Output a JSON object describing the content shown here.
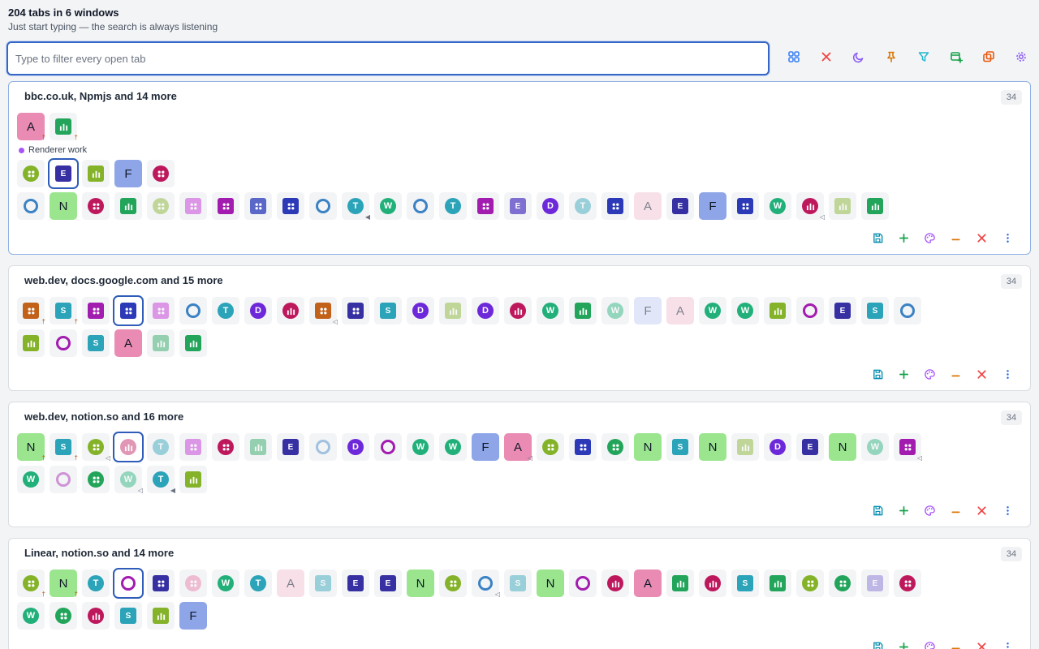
{
  "header": {
    "title": "204 tabs in 6 windows",
    "subtitle": "Just start typing — the search is always listening"
  },
  "search": {
    "placeholder": "Type to filter every open tab",
    "value": ""
  },
  "toolbar": {
    "buttons": [
      {
        "icon": "grid-icon",
        "color": "#3b82f6"
      },
      {
        "icon": "close-x-icon",
        "color": "#ef4444"
      },
      {
        "icon": "moon-icon",
        "color": "#8b5cf6"
      },
      {
        "icon": "pin-icon",
        "color": "#d97706"
      },
      {
        "icon": "filter-icon",
        "color": "#22b8cf"
      },
      {
        "icon": "new-window-icon",
        "color": "#16a34a"
      },
      {
        "icon": "duplicate-icon",
        "color": "#ea580c"
      },
      {
        "icon": "settings-gear-icon",
        "color": "#8b5cf6"
      }
    ]
  },
  "palette": {
    "green": "#65a30d",
    "lime": "#84cc16",
    "indigo": "#3730a3",
    "purple": "#a21caf",
    "magenta": "#be185d",
    "blue": "#3b82c4",
    "teal": "#2ba3b8",
    "emerald": "#22a55a",
    "violet": "#6d28d9",
    "royal": "#2c3ab8",
    "pink": "#e879a6",
    "periwinkle": "#8ea6e8",
    "orange": "#c2611a",
    "lavender": "#7f6fd1"
  },
  "windows": [
    {
      "title": "bbc.co.uk, Npmjs and 14 more",
      "count": "34",
      "group_label": "Renderer work",
      "pinned_row": [
        {
          "kind": "big",
          "letter": "A",
          "bg": "#e98bb3",
          "badge": "pin"
        },
        {
          "kind": "sq",
          "icon": "bars",
          "bg": "#22a55a",
          "badge": "pin"
        }
      ],
      "group_row": [
        {
          "kind": "dots",
          "bg": "#84b32a"
        },
        {
          "kind": "sq",
          "letter": "E",
          "bg": "#3730a3",
          "selected": true
        },
        {
          "kind": "sq",
          "icon": "bars",
          "bg": "#84b32a"
        },
        {
          "kind": "big",
          "letter": "F",
          "bg": "#8ea6e8"
        },
        {
          "kind": "dots",
          "bg": "#be185d"
        }
      ],
      "rows": [
        [
          {
            "kind": "ring",
            "bg": "#3b82c4"
          },
          {
            "kind": "big",
            "letter": "N",
            "bg": "#9be58f"
          },
          {
            "kind": "dots",
            "bg": "#be185d"
          },
          {
            "kind": "sq",
            "icon": "bars",
            "bg": "#22a55a"
          },
          {
            "kind": "dots",
            "bg": "#84b32a",
            "faded": true
          },
          {
            "kind": "sq",
            "icon": "dots",
            "bg": "#c026d3",
            "faded": true
          },
          {
            "kind": "sq",
            "icon": "dots",
            "bg": "#a21caf"
          },
          {
            "kind": "sq",
            "icon": "dots",
            "bg": "#5b68c8"
          },
          {
            "kind": "sq",
            "icon": "dots",
            "bg": "#2c3ab8"
          },
          {
            "kind": "ring",
            "bg": "#3b82c4"
          },
          {
            "kind": "circle",
            "letter": "T",
            "bg": "#2ba3b8",
            "badge": "sound"
          },
          {
            "kind": "circle",
            "letter": "W",
            "bg": "#22b07a"
          },
          {
            "kind": "ring",
            "bg": "#3b82c4"
          },
          {
            "kind": "circle",
            "letter": "T",
            "bg": "#2ba3b8"
          },
          {
            "kind": "sq",
            "icon": "dots",
            "bg": "#a21caf"
          },
          {
            "kind": "sq",
            "letter": "E",
            "bg": "#7f6fd1"
          },
          {
            "kind": "circle",
            "letter": "D",
            "bg": "#6d28d9"
          },
          {
            "kind": "circle",
            "letter": "T",
            "bg": "#2ba3b8",
            "faded": true
          },
          {
            "kind": "sq",
            "icon": "dots",
            "bg": "#2c3ab8"
          },
          {
            "kind": "big",
            "letter": "A",
            "bg": "#f3c7d8",
            "faded": true
          },
          {
            "kind": "sq",
            "letter": "E",
            "bg": "#3730a3"
          },
          {
            "kind": "big",
            "letter": "F",
            "bg": "#8ea6e8"
          },
          {
            "kind": "sq",
            "icon": "dots",
            "bg": "#2c3ab8"
          },
          {
            "kind": "circle",
            "letter": "W",
            "bg": "#22b07a"
          },
          {
            "kind": "circle",
            "icon": "bars",
            "bg": "#be185d",
            "badge": "mute"
          },
          {
            "kind": "sq",
            "icon": "bars",
            "bg": "#84b32a",
            "faded": true
          },
          {
            "kind": "sq",
            "icon": "bars",
            "bg": "#22a55a"
          }
        ]
      ]
    },
    {
      "title": "web.dev, docs.google.com and 15 more",
      "count": "34",
      "rows": [
        [
          {
            "kind": "sq",
            "icon": "dots",
            "bg": "#c2611a",
            "badge": "pin"
          },
          {
            "kind": "sq",
            "letter": "S",
            "bg": "#2ba3b8",
            "badge": "pin"
          },
          {
            "kind": "sq",
            "icon": "dots",
            "bg": "#a21caf"
          },
          {
            "kind": "sq",
            "icon": "dots",
            "bg": "#2c3ab8",
            "selected": true
          },
          {
            "kind": "sq",
            "icon": "dots",
            "bg": "#c026d3",
            "faded": true
          },
          {
            "kind": "ring",
            "bg": "#3b82c4"
          },
          {
            "kind": "circle",
            "letter": "T",
            "bg": "#2ba3b8"
          },
          {
            "kind": "circle",
            "letter": "D",
            "bg": "#6d28d9"
          },
          {
            "kind": "circle",
            "icon": "bars",
            "bg": "#be185d"
          },
          {
            "kind": "sq",
            "icon": "dots",
            "bg": "#c2611a",
            "badge": "mute"
          },
          {
            "kind": "sq",
            "icon": "dots",
            "bg": "#3730a3"
          },
          {
            "kind": "sq",
            "letter": "S",
            "bg": "#2ba3b8"
          },
          {
            "kind": "circle",
            "letter": "D",
            "bg": "#6d28d9"
          },
          {
            "kind": "sq",
            "icon": "bars",
            "bg": "#84b32a",
            "faded": true
          },
          {
            "kind": "circle",
            "letter": "D",
            "bg": "#6d28d9"
          },
          {
            "kind": "circle",
            "icon": "bars",
            "bg": "#be185d"
          },
          {
            "kind": "circle",
            "letter": "W",
            "bg": "#22b07a"
          },
          {
            "kind": "sq",
            "icon": "bars",
            "bg": "#22a55a"
          },
          {
            "kind": "circle",
            "letter": "W",
            "bg": "#22b07a",
            "faded": true
          },
          {
            "kind": "big",
            "letter": "F",
            "bg": "#c9d4f5",
            "faded": true
          },
          {
            "kind": "big",
            "letter": "A",
            "bg": "#f3c7d8",
            "faded": true
          },
          {
            "kind": "circle",
            "letter": "W",
            "bg": "#22b07a"
          },
          {
            "kind": "circle",
            "letter": "W",
            "bg": "#22b07a"
          },
          {
            "kind": "sq",
            "icon": "bars",
            "bg": "#84b32a"
          },
          {
            "kind": "ring",
            "bg": "#a21caf"
          },
          {
            "kind": "sq",
            "letter": "E",
            "bg": "#3730a3"
          },
          {
            "kind": "sq",
            "letter": "S",
            "bg": "#2ba3b8"
          },
          {
            "kind": "ring",
            "bg": "#3b82c4"
          }
        ],
        [
          {
            "kind": "sq",
            "icon": "bars",
            "bg": "#84b32a"
          },
          {
            "kind": "ring",
            "bg": "#a21caf"
          },
          {
            "kind": "sq",
            "letter": "S",
            "bg": "#2ba3b8"
          },
          {
            "kind": "big",
            "letter": "A",
            "bg": "#e98bb3"
          },
          {
            "kind": "sq",
            "icon": "bars",
            "bg": "#22a55a",
            "faded": true
          },
          {
            "kind": "sq",
            "icon": "bars",
            "bg": "#22a55a"
          }
        ]
      ]
    },
    {
      "title": "web.dev, notion.so and 16 more",
      "count": "34",
      "rows": [
        [
          {
            "kind": "big",
            "letter": "N",
            "bg": "#9be58f",
            "badge": "pin"
          },
          {
            "kind": "sq",
            "letter": "S",
            "bg": "#2ba3b8",
            "badge": "pin"
          },
          {
            "kind": "dots",
            "bg": "#84b32a",
            "badge": "mute"
          },
          {
            "kind": "circle",
            "icon": "bars",
            "bg": "#be185d",
            "selected": true,
            "faded": true
          },
          {
            "kind": "circle",
            "letter": "T",
            "bg": "#2ba3b8",
            "faded": true
          },
          {
            "kind": "sq",
            "icon": "dots",
            "bg": "#c026d3",
            "faded": true
          },
          {
            "kind": "dots",
            "bg": "#be185d"
          },
          {
            "kind": "sq",
            "icon": "bars",
            "bg": "#22a55a",
            "faded": true
          },
          {
            "kind": "sq",
            "letter": "E",
            "bg": "#3730a3"
          },
          {
            "kind": "ring",
            "bg": "#3b82c4",
            "faded": true
          },
          {
            "kind": "circle",
            "letter": "D",
            "bg": "#6d28d9"
          },
          {
            "kind": "ring",
            "bg": "#a21caf"
          },
          {
            "kind": "circle",
            "letter": "W",
            "bg": "#22b07a"
          },
          {
            "kind": "circle",
            "letter": "W",
            "bg": "#22b07a"
          },
          {
            "kind": "big",
            "letter": "F",
            "bg": "#8ea6e8"
          },
          {
            "kind": "big",
            "letter": "A",
            "bg": "#e98bb3",
            "badge": "mute"
          },
          {
            "kind": "dots",
            "bg": "#84b32a"
          },
          {
            "kind": "sq",
            "icon": "dots",
            "bg": "#2c3ab8"
          },
          {
            "kind": "dots",
            "bg": "#22a55a"
          },
          {
            "kind": "big",
            "letter": "N",
            "bg": "#9be58f"
          },
          {
            "kind": "sq",
            "letter": "S",
            "bg": "#2ba3b8"
          },
          {
            "kind": "big",
            "letter": "N",
            "bg": "#9be58f"
          },
          {
            "kind": "sq",
            "icon": "bars",
            "bg": "#84b32a",
            "faded": true
          },
          {
            "kind": "circle",
            "letter": "D",
            "bg": "#6d28d9"
          },
          {
            "kind": "sq",
            "letter": "E",
            "bg": "#3730a3"
          },
          {
            "kind": "big",
            "letter": "N",
            "bg": "#9be58f"
          },
          {
            "kind": "circle",
            "letter": "W",
            "bg": "#22b07a",
            "faded": true
          },
          {
            "kind": "sq",
            "icon": "dots",
            "bg": "#a21caf",
            "badge": "mute"
          }
        ],
        [
          {
            "kind": "circle",
            "letter": "W",
            "bg": "#22b07a"
          },
          {
            "kind": "ring",
            "bg": "#a21caf",
            "faded": true
          },
          {
            "kind": "dots",
            "bg": "#22a55a"
          },
          {
            "kind": "circle",
            "letter": "W",
            "bg": "#22b07a",
            "faded": true,
            "badge": "mute"
          },
          {
            "kind": "circle",
            "letter": "T",
            "bg": "#2ba3b8",
            "badge": "sound"
          },
          {
            "kind": "sq",
            "icon": "bars",
            "bg": "#84b32a"
          }
        ]
      ]
    },
    {
      "title": "Linear, notion.so and 14 more",
      "count": "34",
      "rows": [
        [
          {
            "kind": "dots",
            "bg": "#84b32a",
            "badge": "pin"
          },
          {
            "kind": "big",
            "letter": "N",
            "bg": "#9be58f",
            "badge": "pin"
          },
          {
            "kind": "circle",
            "letter": "T",
            "bg": "#2ba3b8"
          },
          {
            "kind": "ring",
            "bg": "#a21caf",
            "selected": true
          },
          {
            "kind": "sq",
            "icon": "dots",
            "bg": "#3730a3"
          },
          {
            "kind": "dots",
            "bg": "#e879a6",
            "faded": true
          },
          {
            "kind": "circle",
            "letter": "W",
            "bg": "#22b07a"
          },
          {
            "kind": "circle",
            "letter": "T",
            "bg": "#2ba3b8"
          },
          {
            "kind": "big",
            "letter": "A",
            "bg": "#f3c7d8",
            "faded": true
          },
          {
            "kind": "sq",
            "letter": "S",
            "bg": "#2ba3b8",
            "faded": true
          },
          {
            "kind": "sq",
            "letter": "E",
            "bg": "#3730a3"
          },
          {
            "kind": "sq",
            "letter": "E",
            "bg": "#3730a3"
          },
          {
            "kind": "big",
            "letter": "N",
            "bg": "#9be58f"
          },
          {
            "kind": "dots",
            "bg": "#84b32a"
          },
          {
            "kind": "ring",
            "bg": "#3b82c4",
            "badge": "mute"
          },
          {
            "kind": "sq",
            "letter": "S",
            "bg": "#2ba3b8",
            "faded": true
          },
          {
            "kind": "big",
            "letter": "N",
            "bg": "#9be58f"
          },
          {
            "kind": "ring",
            "bg": "#a21caf"
          },
          {
            "kind": "circle",
            "icon": "bars",
            "bg": "#be185d"
          },
          {
            "kind": "big",
            "letter": "A",
            "bg": "#e98bb3"
          },
          {
            "kind": "sq",
            "icon": "bars",
            "bg": "#22a55a"
          },
          {
            "kind": "circle",
            "icon": "bars",
            "bg": "#be185d"
          },
          {
            "kind": "sq",
            "letter": "S",
            "bg": "#2ba3b8"
          },
          {
            "kind": "sq",
            "icon": "bars",
            "bg": "#22a55a"
          },
          {
            "kind": "dots",
            "bg": "#84b32a"
          },
          {
            "kind": "dots",
            "bg": "#22a55a"
          },
          {
            "kind": "sq",
            "letter": "E",
            "bg": "#7f6fd1",
            "faded": true
          },
          {
            "kind": "dots",
            "bg": "#be185d"
          }
        ],
        [
          {
            "kind": "circle",
            "letter": "W",
            "bg": "#22b07a"
          },
          {
            "kind": "dots",
            "bg": "#22a55a"
          },
          {
            "kind": "circle",
            "icon": "bars",
            "bg": "#be185d"
          },
          {
            "kind": "sq",
            "letter": "S",
            "bg": "#2ba3b8"
          },
          {
            "kind": "sq",
            "icon": "bars",
            "bg": "#84b32a"
          },
          {
            "kind": "big",
            "letter": "F",
            "bg": "#8ea6e8"
          }
        ]
      ]
    }
  ],
  "window_actions": [
    {
      "name": "save-window-button",
      "icon": "save-icon",
      "color": "#0891b2"
    },
    {
      "name": "new-tab-button",
      "icon": "plus-icon",
      "color": "#16a34a"
    },
    {
      "name": "color-window-button",
      "icon": "palette-icon",
      "color": "#a855f7"
    },
    {
      "name": "minimize-window-button",
      "icon": "minus-icon",
      "color": "#d97706"
    },
    {
      "name": "close-window-button",
      "icon": "close-x-icon",
      "color": "#ef4444"
    },
    {
      "name": "window-menu-button",
      "icon": "more-vertical-icon",
      "color": "#2563eb"
    }
  ]
}
